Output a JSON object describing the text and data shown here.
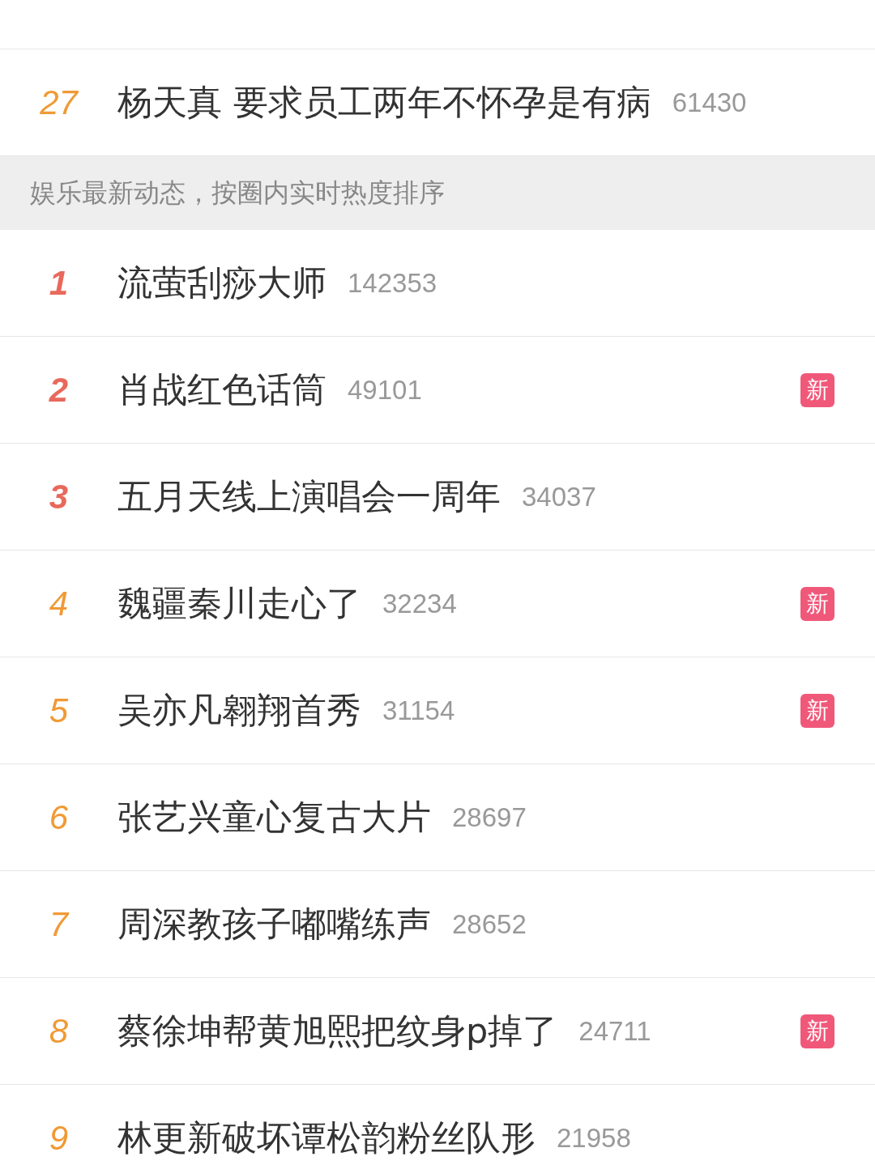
{
  "top_items": [
    {
      "rank": "27",
      "title": "杨天真 要求员工两年不怀孕是有病",
      "count": "61430",
      "color": "#f09a35"
    }
  ],
  "section_header": "娱乐最新动态，按圈内实时热度排序",
  "items": [
    {
      "rank": "1",
      "title": "流萤刮痧大师",
      "count": "142353",
      "color": "#e8695c"
    },
    {
      "rank": "2",
      "title": "肖战红色话筒",
      "count": "49101",
      "color": "#e8695c",
      "badge": "新"
    },
    {
      "rank": "3",
      "title": "五月天线上演唱会一周年",
      "count": "34037",
      "color": "#e8695c"
    },
    {
      "rank": "4",
      "title": "魏疆秦川走心了",
      "count": "32234",
      "color": "#f09a35",
      "badge": "新"
    },
    {
      "rank": "5",
      "title": "吴亦凡翱翔首秀",
      "count": "31154",
      "color": "#f09a35",
      "badge": "新"
    },
    {
      "rank": "6",
      "title": "张艺兴童心复古大片",
      "count": "28697",
      "color": "#f09a35"
    },
    {
      "rank": "7",
      "title": "周深教孩子嘟嘴练声",
      "count": "28652",
      "color": "#f09a35"
    },
    {
      "rank": "8",
      "title": "蔡徐坤帮黄旭熙把纹身p掉了",
      "count": "24711",
      "color": "#f09a35",
      "badge": "新"
    },
    {
      "rank": "9",
      "title": "林更新破坏谭松韵粉丝队形",
      "count": "21958",
      "color": "#f09a35"
    }
  ]
}
